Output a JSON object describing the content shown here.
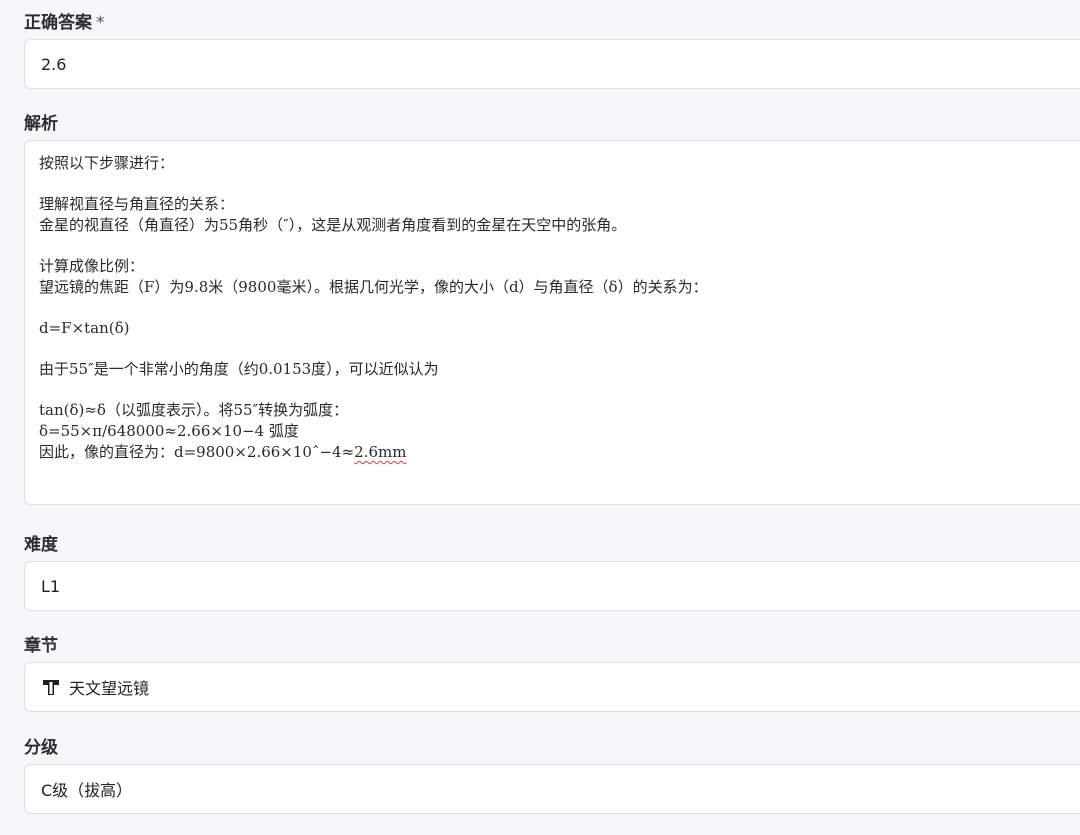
{
  "correct_answer": {
    "label": "正确答案",
    "required_mark": "*",
    "value": "2.6"
  },
  "analysis": {
    "label": "解析",
    "lines": [
      "按照以下步骤进行：",
      "",
      "理解视直径与角直径的关系：",
      "金星的视直径（角直径）为55角秒（″），这是从观测者角度看到的金星在天空中的张角。",
      "",
      "计算成像比例：",
      "望远镜的焦距（F）为9.8米（9800毫米）。根据几何光学，像的大小（d）与角直径（δ）的关系为：",
      "",
      "d=F×tan(δ)",
      "",
      "由于55″是一个非常小的角度（约0.0153度），可以近似认为",
      "",
      "tan(δ)≈δ（以弧度表示）。将55″转换为弧度：",
      "δ=55×π/648000≈2.66×10−4 弧度"
    ],
    "last_line_prefix": "因此，像的直径为：d=9800×2.66×10ˆ−4≈",
    "last_line_flagged": "2.6mm"
  },
  "difficulty": {
    "label": "难度",
    "value": "L1"
  },
  "chapter": {
    "label": "章节",
    "value": "天文望远镜",
    "icon": "tag-icon"
  },
  "grade": {
    "label": "分级",
    "value": "C级（拔高）"
  }
}
